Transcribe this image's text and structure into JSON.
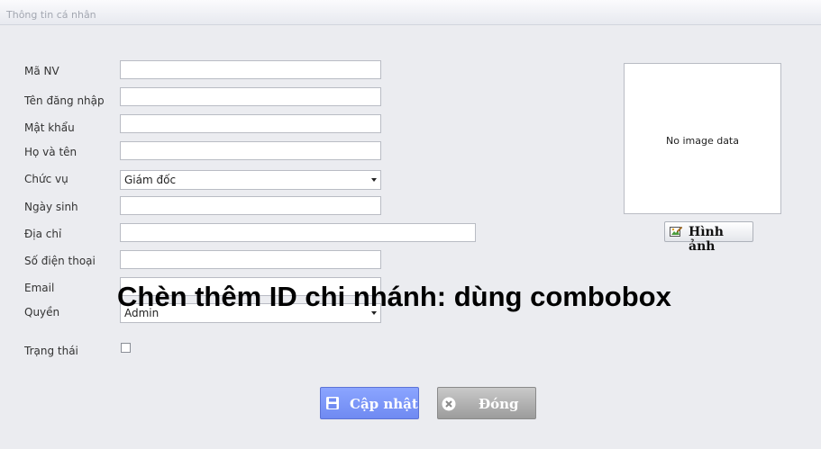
{
  "window": {
    "title": "Thông tin cá nhân"
  },
  "form": {
    "ma_nv": {
      "label": "Mã NV",
      "value": ""
    },
    "ten_dang_nhap": {
      "label": "Tên đăng nhập",
      "value": ""
    },
    "mat_khau": {
      "label": "Mật khẩu",
      "value": ""
    },
    "ho_va_ten": {
      "label": "Họ và tên",
      "value": ""
    },
    "chuc_vu": {
      "label": "Chức vụ",
      "value": "Giám đốc"
    },
    "ngay_sinh": {
      "label": "Ngày sinh",
      "value": ""
    },
    "dia_chi": {
      "label": "Địa chỉ",
      "value": ""
    },
    "so_dien_thoai": {
      "label": "Số điện thoại",
      "value": ""
    },
    "email": {
      "label": "Email",
      "value": ""
    },
    "quyen": {
      "label": "Quyền",
      "value": "Admin"
    },
    "trang_thai": {
      "label": "Trạng thái",
      "checked": false
    }
  },
  "photo": {
    "placeholder": "No image data",
    "button_label": "Hình ảnh"
  },
  "buttons": {
    "update": "Cập nhật",
    "close": "Đóng"
  },
  "annotation": "Chèn thêm ID chi nhánh: dùng combobox",
  "icons": [
    "image-edit-icon",
    "save-icon",
    "close-circle-icon",
    "dropdown-arrow-icon"
  ]
}
